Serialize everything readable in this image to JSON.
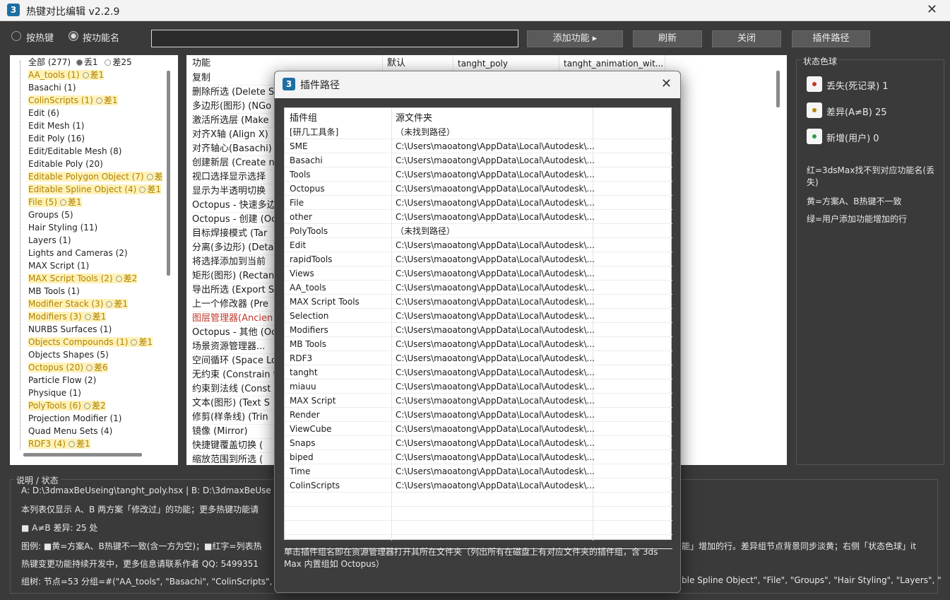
{
  "window": {
    "title": "热键对比编辑 v2.2.9",
    "logo": "3"
  },
  "toolbar": {
    "radio_hotkey": "按热键",
    "radio_function": "按功能名",
    "add_function": "添加功能 ▸",
    "refresh": "刷新",
    "close": "关闭",
    "plugin_path": "插件路径"
  },
  "tree": {
    "root": "全部 (277)",
    "root_lost": "丢1",
    "root_diff": "差25",
    "items": [
      {
        "label": "AA_tools (1)",
        "diff": "差1",
        "hl": true
      },
      {
        "label": "Basachi (1)",
        "diff": "",
        "hl": false
      },
      {
        "label": "ColinScripts (1)",
        "diff": "差1",
        "hl": true
      },
      {
        "label": "Edit (6)",
        "diff": "",
        "hl": false
      },
      {
        "label": "Edit Mesh (1)",
        "diff": "",
        "hl": false
      },
      {
        "label": "Edit Poly (16)",
        "diff": "",
        "hl": false
      },
      {
        "label": "Edit/Editable Mesh (8)",
        "diff": "",
        "hl": false
      },
      {
        "label": "Editable Poly (20)",
        "diff": "",
        "hl": false
      },
      {
        "label": "Editable Polygon Object (7)",
        "diff": "差",
        "hl": true
      },
      {
        "label": "Editable Spline Object (4)",
        "diff": "差1",
        "hl": true
      },
      {
        "label": "File (5)",
        "diff": "差1",
        "hl": true
      },
      {
        "label": "Groups (5)",
        "diff": "",
        "hl": false
      },
      {
        "label": "Hair Styling (11)",
        "diff": "",
        "hl": false
      },
      {
        "label": "Layers (1)",
        "diff": "",
        "hl": false
      },
      {
        "label": "Lights and Cameras (2)",
        "diff": "",
        "hl": false
      },
      {
        "label": "MAX Script (1)",
        "diff": "",
        "hl": false
      },
      {
        "label": "MAX Script Tools (2)",
        "diff": "差2",
        "hl": true
      },
      {
        "label": "MB Tools (1)",
        "diff": "",
        "hl": false
      },
      {
        "label": "Modifier Stack (3)",
        "diff": "差1",
        "hl": true
      },
      {
        "label": "Modifiers (3)",
        "diff": "差1",
        "hl": true
      },
      {
        "label": "NURBS Surfaces (1)",
        "diff": "",
        "hl": false
      },
      {
        "label": "Objects Compounds (1)",
        "diff": "差1",
        "hl": true
      },
      {
        "label": "Objects Shapes (5)",
        "diff": "",
        "hl": false
      },
      {
        "label": "Octopus (20)",
        "diff": "差6",
        "hl": true
      },
      {
        "label": "Particle Flow (2)",
        "diff": "",
        "hl": false
      },
      {
        "label": "Physique (1)",
        "diff": "",
        "hl": false
      },
      {
        "label": "PolyTools (6)",
        "diff": "差2",
        "hl": true
      },
      {
        "label": "Projection Modifier (1)",
        "diff": "",
        "hl": false
      },
      {
        "label": "Quad Menu Sets (4)",
        "diff": "",
        "hl": false
      },
      {
        "label": "RDF3 (4)",
        "diff": "差1",
        "hl": true
      }
    ]
  },
  "main_table": {
    "headers": [
      "功能",
      "默认",
      "tanght_poly",
      "tanght_animation_wit..."
    ],
    "rows": [
      {
        "text": "复制",
        "red": false
      },
      {
        "text": "删除所选 (Delete S",
        "red": false
      },
      {
        "text": "多边形(图形) (NGo",
        "red": false
      },
      {
        "text": "激活所选层 (Make",
        "red": false
      },
      {
        "text": "对齐X轴 (Align X)",
        "red": false
      },
      {
        "text": "对齐轴心(Basachi)",
        "red": false
      },
      {
        "text": "创建新层 (Create n",
        "red": false
      },
      {
        "text": "视口选择显示选择",
        "red": false
      },
      {
        "text": "显示为半透明切换",
        "red": false
      },
      {
        "text": "Octopus - 快速多边",
        "red": false
      },
      {
        "text": "Octopus - 创建 (Oct",
        "red": false
      },
      {
        "text": "目标焊接模式 (Tar",
        "red": false
      },
      {
        "text": "分离(多边形) (Deta",
        "red": false
      },
      {
        "text": "将选择添加到当前",
        "red": false
      },
      {
        "text": "矩形(图形) (Rectan",
        "red": false
      },
      {
        "text": "导出所选 (Export S",
        "red": false
      },
      {
        "text": "上一个修改器 (Pre",
        "red": false
      },
      {
        "text": "图层管理器(Ancien",
        "red": true
      },
      {
        "text": "Octopus - 其他 (Oct",
        "red": false
      },
      {
        "text": "场景资源管理器...",
        "red": false
      },
      {
        "text": "空间循环 (Space Lo",
        "red": false
      },
      {
        "text": "无约束 (Constrain t",
        "red": false
      },
      {
        "text": "约束到法线 (Const",
        "red": false
      },
      {
        "text": "文本(图形) (Text S",
        "red": false
      },
      {
        "text": "修剪(样条线) (Trin",
        "red": false
      },
      {
        "text": "镜像 (Mirror)",
        "red": false
      },
      {
        "text": "快捷键覆盖切换 (",
        "red": false
      },
      {
        "text": "缩放范围到所选 (",
        "red": false
      }
    ]
  },
  "status": {
    "title": "状态色球",
    "items": [
      {
        "label": "丢失(死记录) 1",
        "color": "#c0392b"
      },
      {
        "label": "差异(A≠B) 25",
        "color": "#b8860b"
      },
      {
        "label": "新增(用户) 0",
        "color": "#2e9e4f"
      }
    ],
    "legend_red": "红=3dsMax找不到对应功能名(丢失)",
    "legend_yellow": "黄=方案A、B热键不一致",
    "legend_green": "绿=用户添加功能增加的行"
  },
  "bottom": {
    "title": "说明 / 状态",
    "line1": "A: D:\\3dmaxBeUseing\\tanght_poly.hsx  |  B: D:\\3dmaxBeUse",
    "line2": "本列表仅显示 A、B 两方案「修改过」的功能；更多热键功能请",
    "line3": "■ A≠B 差异: 25 处",
    "line4a": "图例: ■黄=方案A、B热键不一致(含一方为空)；■红字=列表热",
    "line4b": "能」增加的行。差异组节点背景同步淡黄；右侧「状态色球」it",
    "line5": "热键变更功能持续开发中，更多信息请联系作者 QQ: 5499351",
    "line6a": "组树: 节点=53  分组=#(\"AA_tools\", \"Basachi\", \"ColinScripts\",",
    "line6b": "ble Spline Object\", \"File\", \"Groups\", \"Hair Styling\", \"Layers\", \""
  },
  "dialog": {
    "title": "插件路径",
    "logo": "3",
    "headers": [
      "插件组",
      "源文件夹"
    ],
    "rows": [
      {
        "group": "[研几工具条]",
        "path": "（未找到路径）"
      },
      {
        "group": "SME",
        "path": "C:\\Users\\maoatong\\AppData\\Local\\Autodesk\\..."
      },
      {
        "group": "Basachi",
        "path": "C:\\Users\\maoatong\\AppData\\Local\\Autodesk\\..."
      },
      {
        "group": "Tools",
        "path": "C:\\Users\\maoatong\\AppData\\Local\\Autodesk\\..."
      },
      {
        "group": "Octopus",
        "path": "C:\\Users\\maoatong\\AppData\\Local\\Autodesk\\..."
      },
      {
        "group": "File",
        "path": "C:\\Users\\maoatong\\AppData\\Local\\Autodesk\\..."
      },
      {
        "group": "other",
        "path": "C:\\Users\\maoatong\\AppData\\Local\\Autodesk\\..."
      },
      {
        "group": "PolyTools",
        "path": "（未找到路径）"
      },
      {
        "group": "Edit",
        "path": "C:\\Users\\maoatong\\AppData\\Local\\Autodesk\\..."
      },
      {
        "group": "rapidTools",
        "path": "C:\\Users\\maoatong\\AppData\\Local\\Autodesk\\..."
      },
      {
        "group": "Views",
        "path": "C:\\Users\\maoatong\\AppData\\Local\\Autodesk\\..."
      },
      {
        "group": "AA_tools",
        "path": "C:\\Users\\maoatong\\AppData\\Local\\Autodesk\\..."
      },
      {
        "group": "MAX Script Tools",
        "path": "C:\\Users\\maoatong\\AppData\\Local\\Autodesk\\..."
      },
      {
        "group": "Selection",
        "path": "C:\\Users\\maoatong\\AppData\\Local\\Autodesk\\..."
      },
      {
        "group": "Modifiers",
        "path": "C:\\Users\\maoatong\\AppData\\Local\\Autodesk\\..."
      },
      {
        "group": "MB Tools",
        "path": "C:\\Users\\maoatong\\AppData\\Local\\Autodesk\\..."
      },
      {
        "group": "RDF3",
        "path": "C:\\Users\\maoatong\\AppData\\Local\\Autodesk\\..."
      },
      {
        "group": "tanght",
        "path": "C:\\Users\\maoatong\\AppData\\Local\\Autodesk\\..."
      },
      {
        "group": "miauu",
        "path": "C:\\Users\\maoatong\\AppData\\Local\\Autodesk\\..."
      },
      {
        "group": "MAX Script",
        "path": "C:\\Users\\maoatong\\AppData\\Local\\Autodesk\\..."
      },
      {
        "group": "Render",
        "path": "C:\\Users\\maoatong\\AppData\\Local\\Autodesk\\..."
      },
      {
        "group": "ViewCube",
        "path": "C:\\Users\\maoatong\\AppData\\Local\\Autodesk\\..."
      },
      {
        "group": "Snaps",
        "path": "C:\\Users\\maoatong\\AppData\\Local\\Autodesk\\..."
      },
      {
        "group": "biped",
        "path": "C:\\Users\\maoatong\\AppData\\Local\\Autodesk\\..."
      },
      {
        "group": "Time",
        "path": "C:\\Users\\maoatong\\AppData\\Local\\Autodesk\\..."
      },
      {
        "group": "ColinScripts",
        "path": "C:\\Users\\maoatong\\AppData\\Local\\Autodesk\\..."
      }
    ],
    "note": "单击插件组名即在资源管理器打开其所在文件夹（列出所有在磁盘上有对应文件夹的插件组，含 3ds Max 内置组如 Octopus）"
  }
}
